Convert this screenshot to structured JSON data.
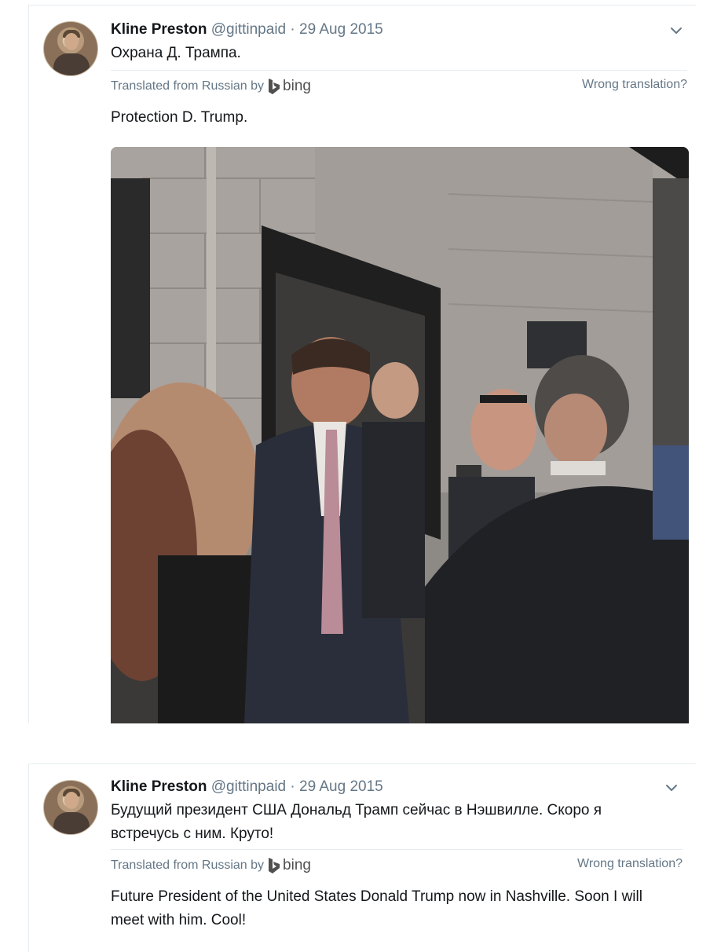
{
  "tweets": [
    {
      "name": "Kline Preston",
      "handle": "@gittinpaid",
      "separator": "·",
      "date": "29 Aug 2015",
      "text": "Охрана Д. Трампа.",
      "translation_label": "Translated from Russian by",
      "translation_engine": "bing",
      "wrong_translation": "Wrong translation?",
      "translated_text": "Protection D. Trump.",
      "has_photo": true
    },
    {
      "name": "Kline Preston",
      "handle": "@gittinpaid",
      "separator": "·",
      "date": "29 Aug 2015",
      "text_line1": "Будущий президент США Дональд Трамп сейчас в Нэшвилле. Скоро я",
      "text_line2": "встречусь с  ним. Круто!",
      "translation_label": "Translated from Russian by",
      "translation_engine": "bing",
      "wrong_translation": "Wrong translation?",
      "translated_line1": "Future President of the United States Donald Trump now in Nashville. Soon I will",
      "translated_line2": "meet with him. Cool!"
    }
  ],
  "colors": {
    "primary_text": "#14171a",
    "secondary_text": "#657786",
    "border": "#e6ecf0",
    "bing_logo": "#505050"
  },
  "icons": {
    "avatar": "profile-photo",
    "chevron": "chevron-down-icon",
    "bing": "bing-logo-icon"
  }
}
